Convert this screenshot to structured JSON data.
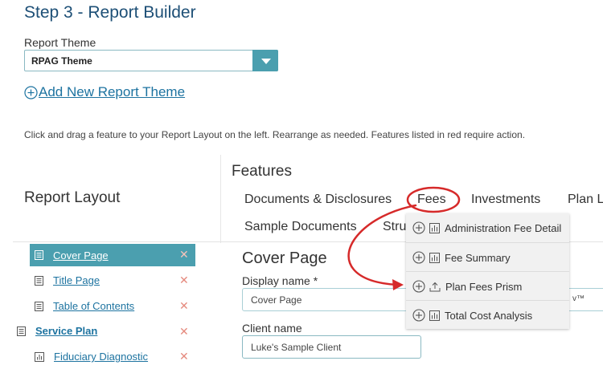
{
  "header": {
    "step_title": "Step 3 - Report Builder",
    "theme_label": "Report Theme",
    "theme_value": "RPAG Theme",
    "add_theme_label": "Add New Report Theme"
  },
  "instructions": "Click and drag a feature to your Report Layout on the left. Rearrange as needed. Features listed in red require action.",
  "features": {
    "title": "Features",
    "tabs": [
      "Documents & Disclosures",
      "Fees",
      "Investments",
      "Plan L",
      "Sample Documents",
      "Stru"
    ],
    "fees_menu": [
      {
        "label": "Administration Fee Detail",
        "icon": "bar-chart-icon"
      },
      {
        "label": "Fee Summary",
        "icon": "bar-chart-icon"
      },
      {
        "label": "Plan Fees Prism",
        "icon": "upload-icon"
      },
      {
        "label": "Total Cost Analysis",
        "icon": "bar-chart-icon"
      }
    ]
  },
  "layout": {
    "title": "Report Layout",
    "items": [
      {
        "label": "Cover Page",
        "icon": "document-icon",
        "selected": true
      },
      {
        "label": "Title Page",
        "icon": "document-icon"
      },
      {
        "label": "Table of Contents",
        "icon": "document-icon"
      },
      {
        "label": "Service Plan",
        "icon": "document-icon"
      },
      {
        "label": "Fiduciary Diagnostic",
        "icon": "bar-chart-icon"
      }
    ],
    "remove_symbol": "✕"
  },
  "detail": {
    "title": "Cover Page",
    "display_label": "Display name *",
    "display_value": "Cover Page",
    "tm": "v™",
    "client_label": "Client name",
    "client_value": "Luke's Sample Client"
  },
  "colors": {
    "primary": "#1d4f76",
    "link": "#1d73a0",
    "teal": "#4b9faf",
    "annotation": "#d62a2a",
    "remove": "#e58a7e"
  }
}
